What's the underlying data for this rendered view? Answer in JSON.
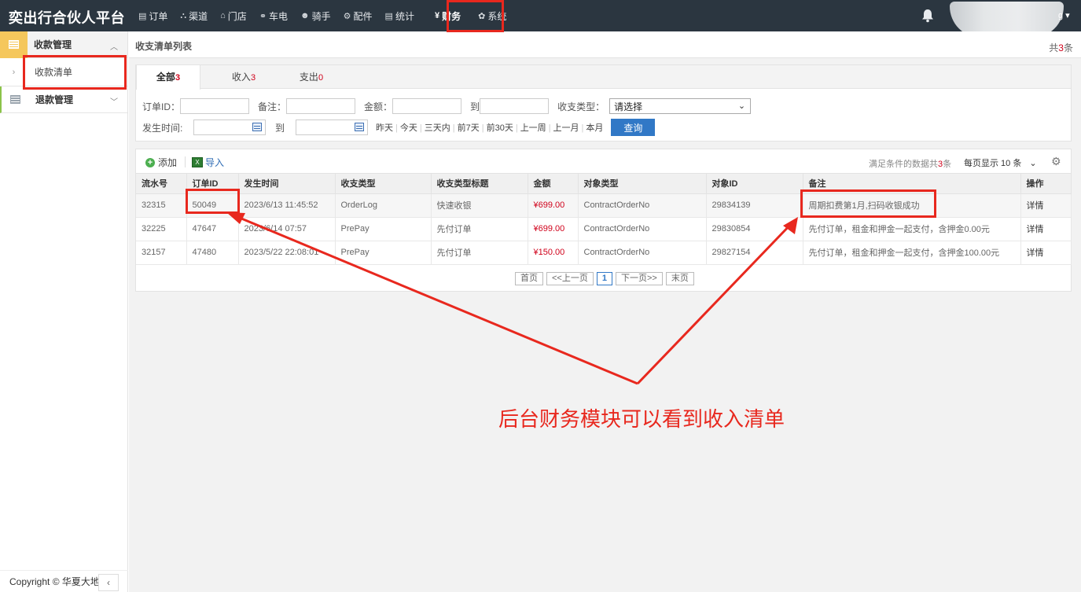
{
  "app": {
    "title": "奕出行合伙人平台"
  },
  "nav": {
    "items": [
      {
        "icon": "▤",
        "label": "订单"
      },
      {
        "icon": "⛬",
        "label": "渠道"
      },
      {
        "icon": "⌂",
        "label": "门店"
      },
      {
        "icon": "⚭",
        "label": "车电"
      },
      {
        "icon": "☻",
        "label": "骑手"
      },
      {
        "icon": "⚙",
        "label": "配件"
      },
      {
        "icon": "▤",
        "label": "统计"
      },
      {
        "icon": "¥",
        "label": "财务"
      },
      {
        "icon": "✿",
        "label": "系统"
      }
    ],
    "user_tail": "g ▾"
  },
  "sidebar": {
    "group1": "收款管理",
    "group1_item": "收款清单",
    "group2": "退款管理",
    "footer": "Copyright © 华夏大地",
    "collapse": "‹"
  },
  "page": {
    "title": "收支清单列表",
    "count_prefix": "共",
    "count": "3",
    "count_suffix": "条"
  },
  "tabs": [
    {
      "label": "全部",
      "count": "3"
    },
    {
      "label": "收入",
      "count": "3"
    },
    {
      "label": "支出",
      "count": "0"
    }
  ],
  "filters": {
    "order_id_label": "订单ID：",
    "remark_label": "备注：",
    "amount_label": "金额：",
    "to_label": "到",
    "type_label": "收支类型：",
    "type_value": "请选择",
    "time_label": "发生时间:",
    "quick": [
      "昨天",
      "今天",
      "三天内",
      "前7天",
      "前30天",
      "上一周",
      "上一月",
      "本月"
    ],
    "query_btn": "查询"
  },
  "toolbar": {
    "add": "添加",
    "import": "导入",
    "info_prefix": "满足条件的数据共",
    "info_count": "3",
    "info_suffix": "条",
    "page_size": "每页显示 10 条"
  },
  "table": {
    "headers": [
      "流水号",
      "订单ID",
      "发生时间",
      "收支类型",
      "收支类型标题",
      "金额",
      "对象类型",
      "对象ID",
      "备注",
      "操作"
    ],
    "rows": [
      [
        "32315",
        "50049",
        "2023/6/13 11:45:52",
        "OrderLog",
        "快速收银",
        "¥699.00",
        "ContractOrderNo",
        "29834139",
        "周期扣费第1月,扫码收银成功",
        "详情"
      ],
      [
        "32225",
        "47647",
        "2023/6/14 07:57",
        "PrePay",
        "先付订单",
        "¥699.00",
        "ContractOrderNo",
        "29830854",
        "先付订单，租金和押金一起支付，含押金0.00元",
        "详情"
      ],
      [
        "32157",
        "47480",
        "2023/5/22 22:08:01",
        "PrePay",
        "先付订单",
        "¥150.00",
        "ContractOrderNo",
        "29827154",
        "先付订单，租金和押金一起支付，含押金100.00元",
        "详情"
      ]
    ]
  },
  "pager": {
    "first": "首页",
    "prev": "<<上一页",
    "current": "1",
    "next": "下一页>>",
    "last": "末页"
  },
  "annotation": {
    "text": "后台财务模块可以看到收入清单",
    "color": "#e8281e"
  }
}
